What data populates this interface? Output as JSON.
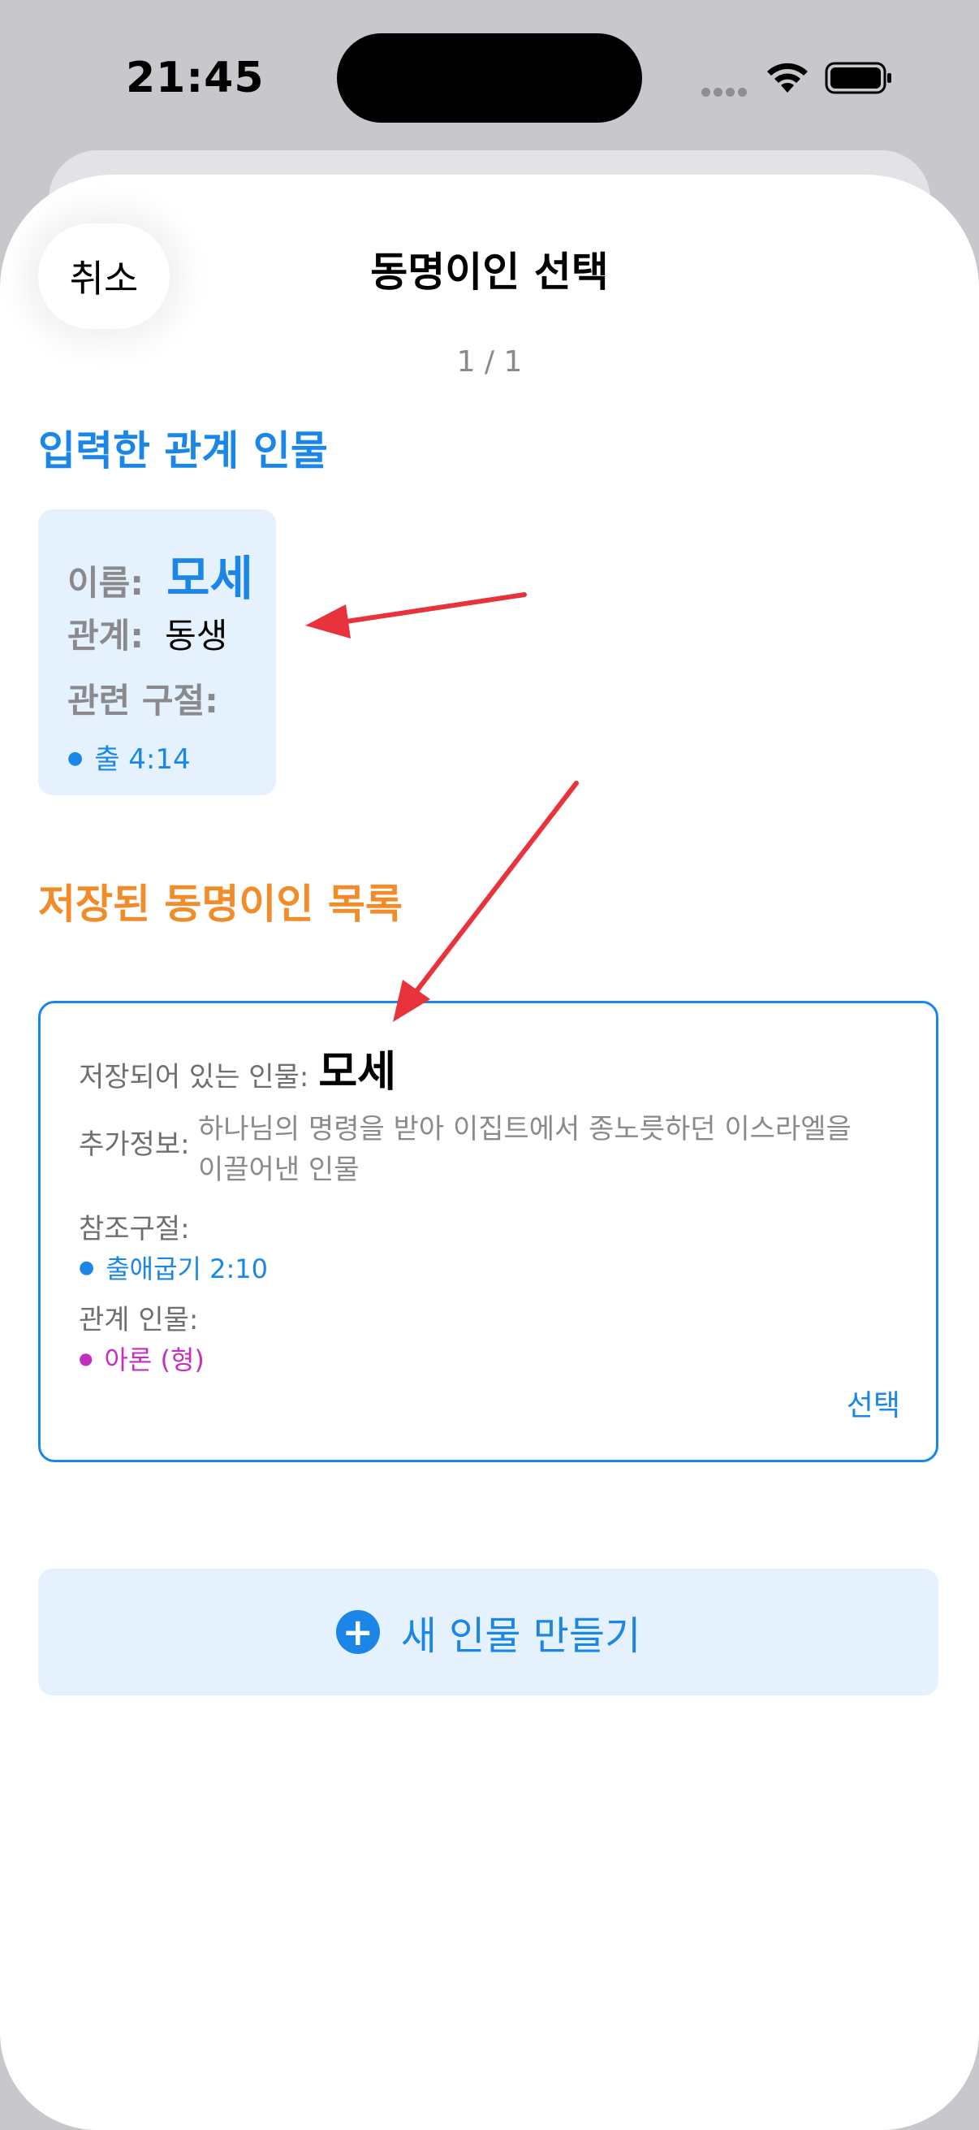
{
  "status_bar": {
    "time": "21:45"
  },
  "header": {
    "cancel_label": "취소",
    "title": "동명이인 선택",
    "page_indicator": "1 / 1"
  },
  "input_section": {
    "title": "입력한 관계 인물",
    "name_label": "이름:",
    "name_value": "모세",
    "relation_label": "관계:",
    "relation_value": "동생",
    "verses_label": "관련 구절:",
    "verses": [
      "출 4:14"
    ]
  },
  "saved_section": {
    "title": "저장된 동명이인 목록",
    "items": [
      {
        "stored_label": "저장되어 있는 인물:",
        "name": "모세",
        "extra_label": "추가정보:",
        "extra_text": "하나님의 명령을 받아 이집트에서 종노릇하던 이스라엘을 이끌어낸 인물",
        "verses_label": "참조구절:",
        "verses": [
          "출애굽기 2:10"
        ],
        "relations_label": "관계 인물:",
        "relations": [
          "아론 (형)"
        ],
        "select_label": "선택"
      }
    ]
  },
  "new_person_button": {
    "label": "새 인물 만들기",
    "icon": "plus-circle-icon"
  },
  "colors": {
    "accent_blue": "#1a87e8",
    "accent_orange": "#f28c28",
    "relation_purple": "#c42ec1",
    "annotation_red": "#e8323c",
    "card_background": "#e5f1fd"
  }
}
